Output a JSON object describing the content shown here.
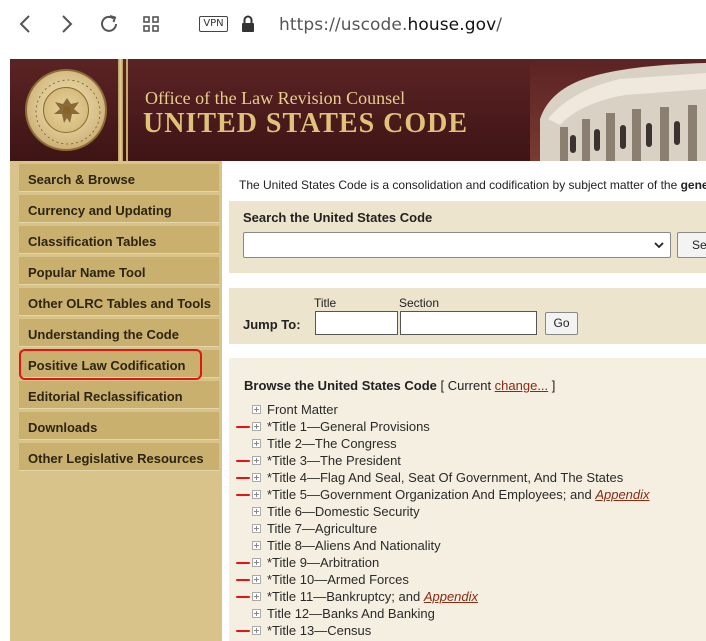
{
  "browser": {
    "vpn_label": "VPN",
    "url_prefix": "https://uscode.",
    "url_domain": "house.gov",
    "url_suffix": "/"
  },
  "header": {
    "subtitle": "Office of the Law Revision Counsel",
    "title": "UNITED STATES CODE"
  },
  "sidebar": {
    "items": [
      {
        "label": "Search & Browse"
      },
      {
        "label": "Currency and Updating"
      },
      {
        "label": "Classification Tables"
      },
      {
        "label": "Popular Name Tool"
      },
      {
        "label": "Other OLRC Tables and Tools"
      },
      {
        "label": "Understanding the Code"
      },
      {
        "label": "Positive Law Codification"
      },
      {
        "label": "Editorial Reclassification"
      },
      {
        "label": "Downloads"
      },
      {
        "label": "Other Legislative Resources"
      }
    ]
  },
  "intro": {
    "text": "The United States Code is a consolidation and codification by subject matter of the ",
    "bold": "gene"
  },
  "search": {
    "label": "Search the United States Code",
    "button_label": "Se"
  },
  "jump": {
    "label": "Jump To:",
    "title_label": "Title",
    "section_label": "Section",
    "go_label": "Go"
  },
  "browse": {
    "heading": "Browse the United States Code",
    "current_open": " [ Current ",
    "change_link": "change...",
    "current_close": " ]",
    "titles": [
      {
        "text": "Front Matter",
        "appendix": ""
      },
      {
        "text": "*Title 1—General Provisions",
        "appendix": ""
      },
      {
        "text": "Title 2—The Congress",
        "appendix": ""
      },
      {
        "text": "*Title 3—The President",
        "appendix": ""
      },
      {
        "text": "*Title 4—Flag And Seal, Seat Of Government, And The States",
        "appendix": ""
      },
      {
        "text": "*Title 5—Government Organization And Employees; and ",
        "appendix": "Appendix"
      },
      {
        "text": "Title 6—Domestic Security",
        "appendix": ""
      },
      {
        "text": "Title 7—Agriculture",
        "appendix": ""
      },
      {
        "text": "Title 8—Aliens And Nationality",
        "appendix": ""
      },
      {
        "text": "*Title 9—Arbitration",
        "appendix": ""
      },
      {
        "text": "*Title 10—Armed Forces",
        "appendix": ""
      },
      {
        "text": "*Title 11—Bankruptcy; and ",
        "appendix": "Appendix"
      },
      {
        "text": "Title 12—Banks And Banking",
        "appendix": ""
      },
      {
        "text": "*Title 13—Census",
        "appendix": ""
      }
    ]
  },
  "colors": {
    "header_bg": "#4a1a1b",
    "header_gold": "#e0c27a",
    "sidebar_bg": "#d8c38a",
    "nav_item_bg": "#c9b06e",
    "panel_bg": "#ece4cc",
    "link": "#8a2a12",
    "annotation_red": "#e01515"
  }
}
